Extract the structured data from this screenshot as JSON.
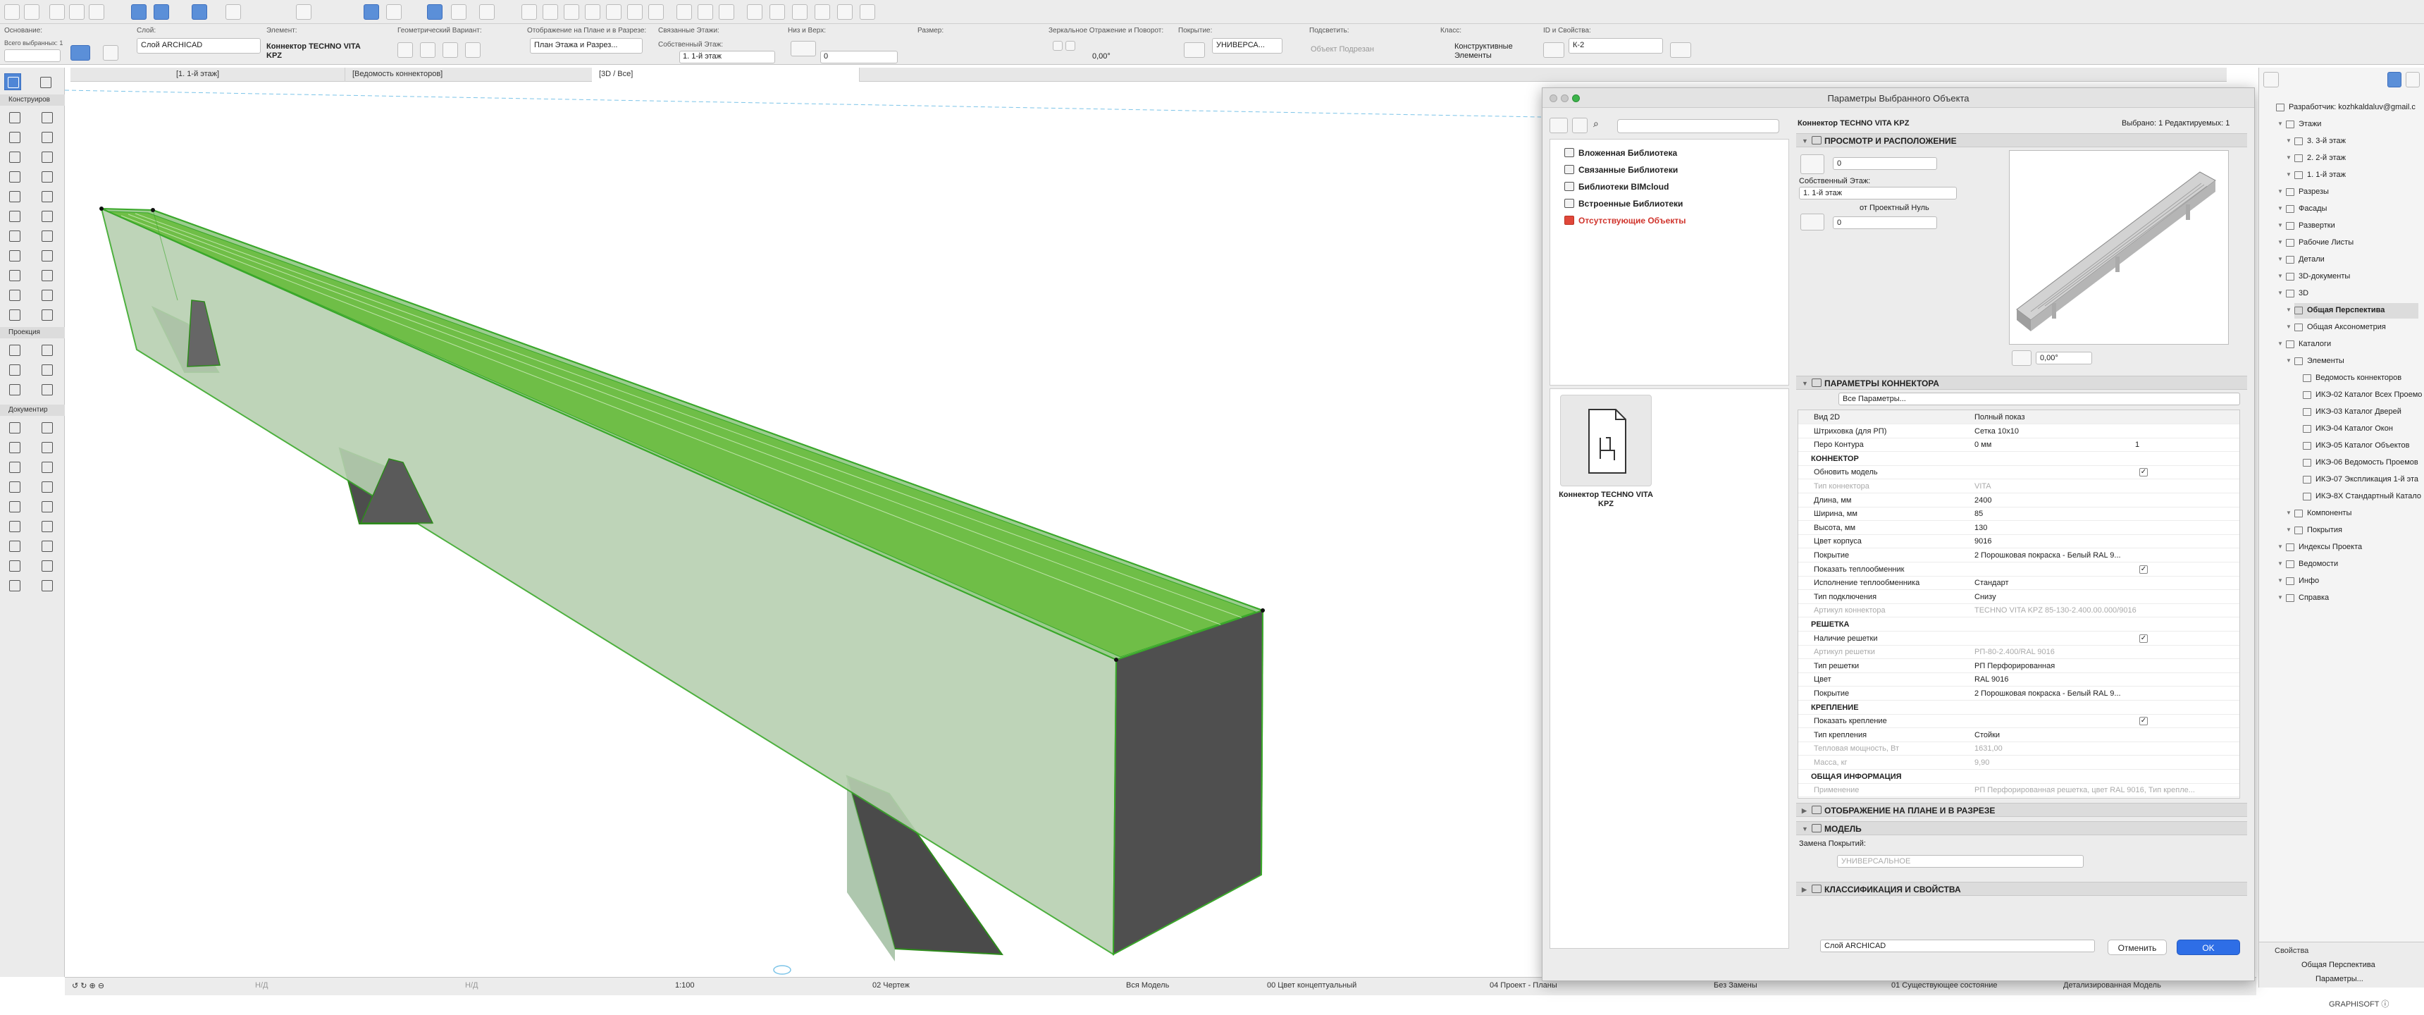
{
  "infobox": {
    "osnovanie_label": "Основание:",
    "selected_count": "Всего выбранных: 1",
    "layer_label": "Слой:",
    "layer_value": "Слой ARCHICAD",
    "element_label": "Элемент:",
    "element_value_line1": "Коннектор TECHNO VITA",
    "element_value_line2": "KPZ",
    "geom_label": "Геометрический Вариант:",
    "plan_display_label": "Отображение на Плане и в Разрезе:",
    "plan_display_value": "План Этажа и Разрез...",
    "linked_floors_label": "Связанные Этажи:",
    "own_floor_label": "Собственный Этаж:",
    "own_floor_value": "1. 1-й этаж",
    "height_label": "Низ и Верх:",
    "height_value": "0",
    "size_label": "Размер:",
    "mirror_label": "Зеркальное Отражение и Поворот:",
    "angle_value": "0,00°",
    "surface_label": "Покрытие:",
    "surface_value": "УНИВЕРСА...",
    "highlight_label": "Подсветить:",
    "highlight_value": "Объект Подрезан",
    "class_label": "Класс:",
    "class_value_line1": "Конструктивные",
    "class_value_line2": "Элементы",
    "id_label": "ID и Свойства:",
    "id_value": "К-2"
  },
  "tabs": [
    {
      "label": "[1. 1-й этаж]"
    },
    {
      "label": "[Ведомость коннекторов]"
    },
    {
      "label": "[3D / Все]"
    }
  ],
  "toolbox": {
    "section_construct": "Конструиров",
    "section_projection": "Проекция",
    "section_document": "Документир"
  },
  "statusbar": {
    "nd1": "Н/Д",
    "nd2": "Н/Д",
    "scale": "1:100",
    "drawing": "02 Чертеж",
    "model": "Вся Модель",
    "color": "00 Цвет концептуальный",
    "project": "04 Проект - Планы",
    "override": "Без Замены",
    "state": "01 Существующее состояние",
    "detail": "Детализированная Модель"
  },
  "dialog": {
    "title": "Параметры Выбранного Объекта",
    "object_name": "Коннектор TECHNO VITA KPZ",
    "selected_editable": "Выбрано: 1 Редактируемых: 1",
    "libraries": [
      {
        "label": "Вложенная Библиотека",
        "red": false
      },
      {
        "label": "Связанные Библиотеки",
        "red": false
      },
      {
        "label": "Библиотеки BIMcloud",
        "red": false
      },
      {
        "label": "Встроенные Библиотеки",
        "red": false
      },
      {
        "label": "Отсутствующие Объекты",
        "red": true
      }
    ],
    "preview_caption_line1": "Коннектор TECHNO VITA",
    "preview_caption_line2": "KPZ",
    "section_view": "ПРОСМОТР И РАСПОЛОЖЕНИЕ",
    "top_value": "0",
    "own_floor_label": "Собственный Этаж:",
    "own_floor_value": "1. 1-й этаж",
    "from_zero": "от Проектный Нуль",
    "bottom_value": "0",
    "rotation_value": "0,00°",
    "section_params": "ПАРАМЕТРЫ КОННЕКТОРА",
    "all_params": "Все Параметры...",
    "params": [
      {
        "name": "Вид 2D",
        "value": "Полный показ",
        "type": "header"
      },
      {
        "name": "Штриховка (для РП)",
        "value": "Сетка 10х10",
        "type": "row"
      },
      {
        "name": "Перо Контура",
        "value": "0 мм",
        "extra": "1",
        "type": "row"
      },
      {
        "name": "КОННЕКТОР",
        "value": "",
        "type": "group"
      },
      {
        "name": "Обновить модель",
        "value": "",
        "type": "check"
      },
      {
        "name": "Тип коннектора",
        "value": "VITA",
        "type": "dim"
      },
      {
        "name": "Длина, мм",
        "value": "2400",
        "type": "row"
      },
      {
        "name": "Ширина, мм",
        "value": "85",
        "type": "row"
      },
      {
        "name": "Высота, мм",
        "value": "130",
        "type": "row"
      },
      {
        "name": "Цвет корпуса",
        "value": "9016",
        "type": "row"
      },
      {
        "name": "Покрытие",
        "value": "2 Порошковая покраска - Белый RAL 9...",
        "type": "row"
      },
      {
        "name": "Показать теплообменник",
        "value": "",
        "type": "check"
      },
      {
        "name": "Исполнение теплообменника",
        "value": "Стандарт",
        "type": "row"
      },
      {
        "name": "Тип подключения",
        "value": "Снизу",
        "type": "row"
      },
      {
        "name": "Артикул коннектора",
        "value": "TECHNO VITA KPZ  85-130-2.400.00.000/9016",
        "type": "dim"
      },
      {
        "name": "РЕШЕТКА",
        "value": "",
        "type": "group"
      },
      {
        "name": "Наличие решетки",
        "value": "",
        "type": "check"
      },
      {
        "name": "Артикул решетки",
        "value": "РП-80-2.400/RAL 9016",
        "type": "dim"
      },
      {
        "name": "Тип решетки",
        "value": "РП Перфорированная",
        "type": "row"
      },
      {
        "name": "Цвет",
        "value": "RAL 9016",
        "type": "row"
      },
      {
        "name": "Покрытие",
        "value": "2 Порошковая покраска - Белый RAL 9...",
        "type": "row"
      },
      {
        "name": "КРЕПЛЕНИЕ",
        "value": "",
        "type": "group"
      },
      {
        "name": "Показать крепление",
        "value": "",
        "type": "check"
      },
      {
        "name": "Тип крепления",
        "value": "Стойки",
        "type": "row"
      },
      {
        "name": "Тепловая мощность, Вт",
        "value": "1631,00",
        "type": "dim"
      },
      {
        "name": "Масса, кг",
        "value": "9,90",
        "type": "dim"
      },
      {
        "name": "ОБЩАЯ ИНФОРМАЦИЯ",
        "value": "",
        "type": "group"
      },
      {
        "name": "Применение",
        "value": "РП Перфорированная решетка, цвет RAL 9016, Тип крепле...",
        "type": "dim"
      }
    ],
    "section_plan": "ОТОБРАЖЕНИЕ НА ПЛАНЕ И В РАЗРЕЗЕ",
    "section_model": "МОДЕЛЬ",
    "surface_override_label": "Замена Покрытий:",
    "surface_override_value": "УНИВЕРСАЛЬНОЕ",
    "section_class": "КЛАССИФИКАЦИЯ И СВОЙСТВА",
    "layer_value": "Слой ARCHICAD",
    "cancel": "Отменить",
    "ok": "OK"
  },
  "navigator": {
    "user": "Разработчик: kozhkaldaluv@gmail.c",
    "items": [
      {
        "label": "Этажи",
        "level": 1,
        "sel": false
      },
      {
        "label": "3. 3-й этаж",
        "level": 2,
        "sel": false
      },
      {
        "label": "2. 2-й этаж",
        "level": 2,
        "sel": false
      },
      {
        "label": "1. 1-й этаж",
        "level": 2,
        "sel": false
      },
      {
        "label": "Разрезы",
        "level": 1,
        "sel": false
      },
      {
        "label": "Фасады",
        "level": 1,
        "sel": false
      },
      {
        "label": "Развертки",
        "level": 1,
        "sel": false
      },
      {
        "label": "Рабочие Листы",
        "level": 1,
        "sel": false
      },
      {
        "label": "Детали",
        "level": 1,
        "sel": false
      },
      {
        "label": "3D-документы",
        "level": 1,
        "sel": false
      },
      {
        "label": "3D",
        "level": 1,
        "sel": false
      },
      {
        "label": "Общая Перспектива",
        "level": 2,
        "sel": true
      },
      {
        "label": "Общая Аксонометрия",
        "level": 2,
        "sel": false
      },
      {
        "label": "Каталоги",
        "level": 1,
        "sel": false
      },
      {
        "label": "Элементы",
        "level": 2,
        "sel": false
      },
      {
        "label": "Ведомость коннекторов",
        "level": 3,
        "sel": false
      },
      {
        "label": "ИКЭ-02 Каталог Всех Проемо",
        "level": 3,
        "sel": false
      },
      {
        "label": "ИКЭ-03 Каталог Дверей",
        "level": 3,
        "sel": false
      },
      {
        "label": "ИКЭ-04 Каталог Окон",
        "level": 3,
        "sel": false
      },
      {
        "label": "ИКЭ-05 Каталог Объектов",
        "level": 3,
        "sel": false
      },
      {
        "label": "ИКЭ-06 Ведомость Проемов",
        "level": 3,
        "sel": false
      },
      {
        "label": "ИКЭ-07 Экспликация 1-й эта",
        "level": 3,
        "sel": false
      },
      {
        "label": "ИКЭ-8Х Стандартный Катало",
        "level": 3,
        "sel": false
      },
      {
        "label": "Компоненты",
        "level": 2,
        "sel": false
      },
      {
        "label": "Покрытия",
        "level": 2,
        "sel": false
      },
      {
        "label": "Индексы Проекта",
        "level": 1,
        "sel": false
      },
      {
        "label": "Ведомости",
        "level": 1,
        "sel": false
      },
      {
        "label": "Инфо",
        "level": 1,
        "sel": false
      },
      {
        "label": "Справка",
        "level": 1,
        "sel": false
      }
    ],
    "props_title": "Свойства",
    "props_value": "Общая Перспектива",
    "props_button": "Параметры..."
  },
  "footer_brand": "GRAPHISOFT ⓘ"
}
